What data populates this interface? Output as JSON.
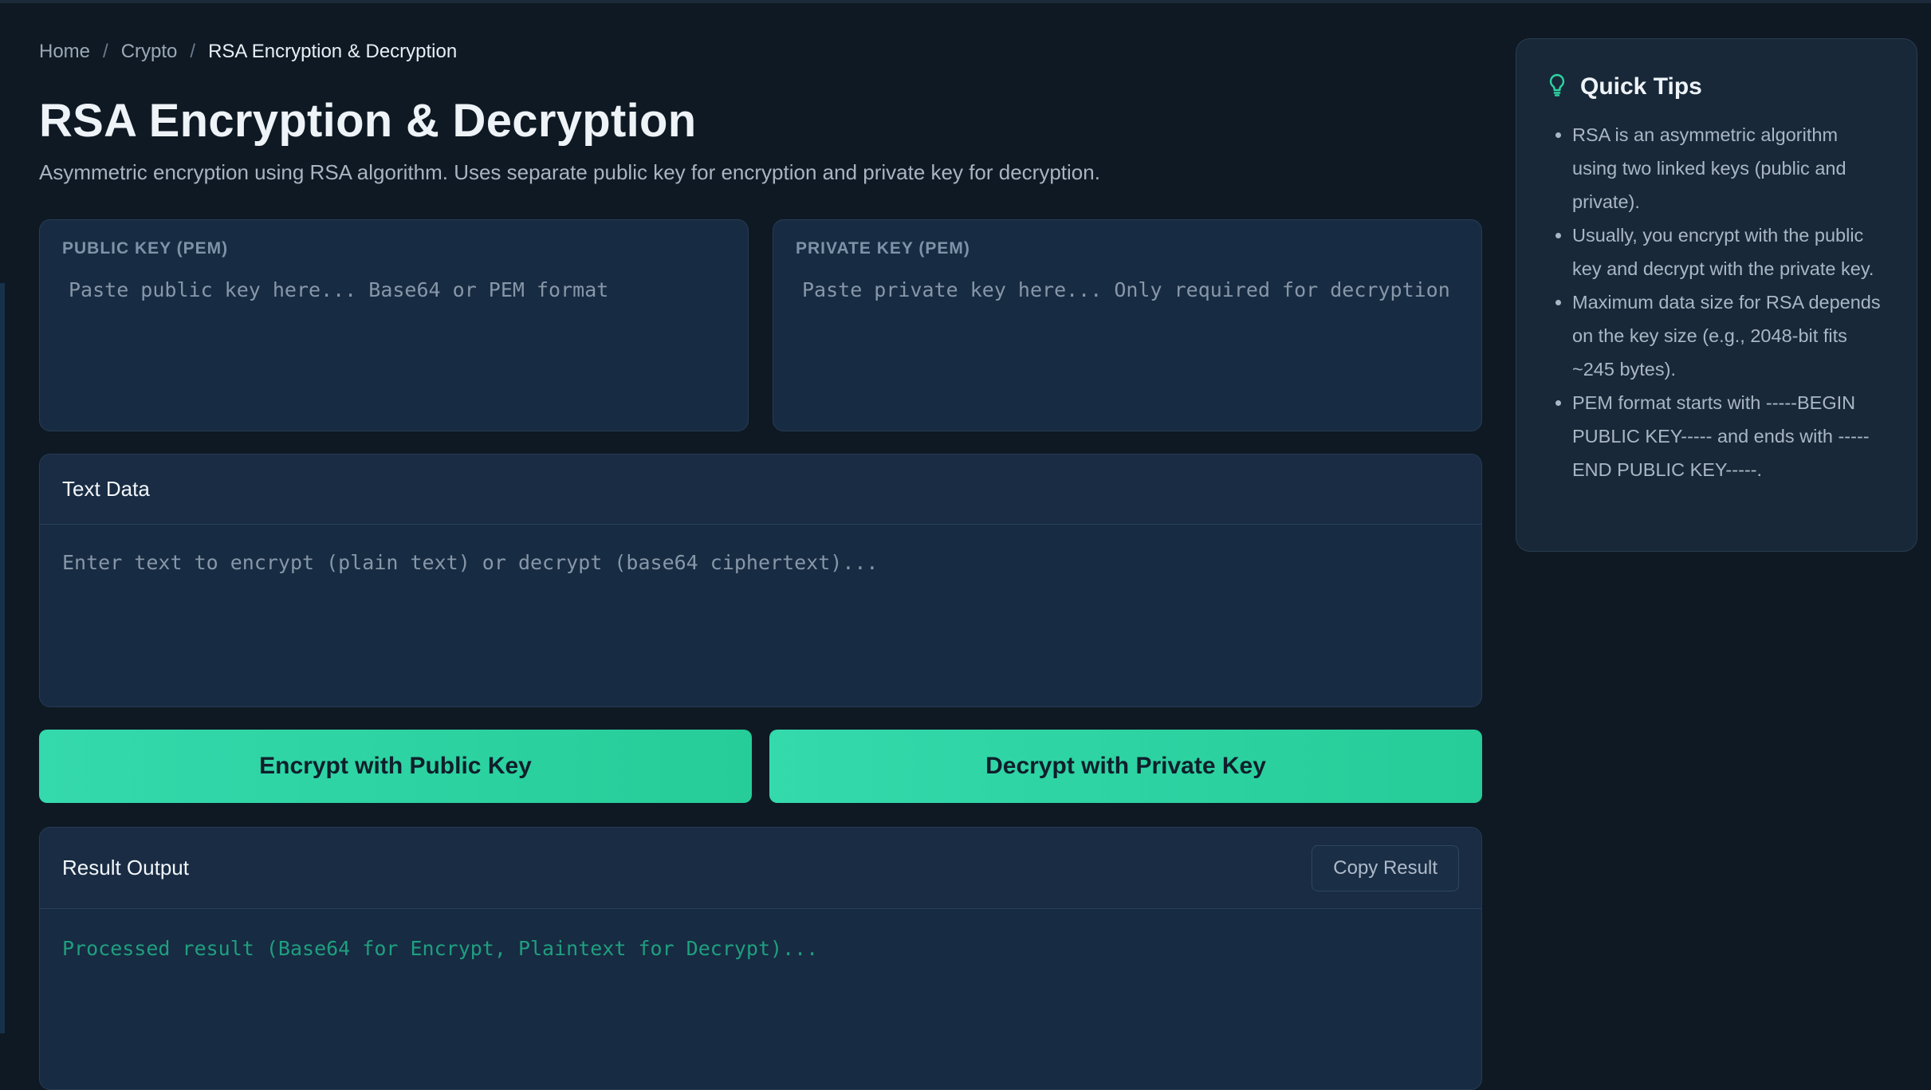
{
  "breadcrumb": {
    "home": "Home",
    "crypto": "Crypto",
    "current": "RSA Encryption & Decryption",
    "separator": "/"
  },
  "page": {
    "title": "RSA Encryption & Decryption",
    "description": "Asymmetric encryption using RSA algorithm. Uses separate public key for encryption and private key for decryption."
  },
  "public_key": {
    "label": "PUBLIC KEY (PEM)",
    "placeholder": "Paste public key here... Base64 or PEM format"
  },
  "private_key": {
    "label": "PRIVATE KEY (PEM)",
    "placeholder": "Paste private key here... Only required for decryption"
  },
  "text_data": {
    "title": "Text Data",
    "placeholder": "Enter text to encrypt (plain text) or decrypt (base64 ciphertext)..."
  },
  "actions": {
    "encrypt": "Encrypt with Public Key",
    "decrypt": "Decrypt with Private Key"
  },
  "result": {
    "title": "Result Output",
    "copy": "Copy Result",
    "placeholder": "Processed result (Base64 for Encrypt, Plaintext for Decrypt)..."
  },
  "tips": {
    "title": "Quick Tips",
    "icon": "lightbulb-icon",
    "items": [
      "RSA is an asymmetric algorithm using two linked keys (public and private).",
      "Usually, you encrypt with the public key and decrypt with the private key.",
      "Maximum data size for RSA depends on the key size (e.g., 2048-bit fits ~245 bytes).",
      "PEM format starts with -----BEGIN PUBLIC KEY----- and ends with -----END PUBLIC KEY-----."
    ]
  },
  "colors": {
    "accent": "#2ed3a2",
    "background": "#0f1923",
    "card": "#172b42"
  }
}
